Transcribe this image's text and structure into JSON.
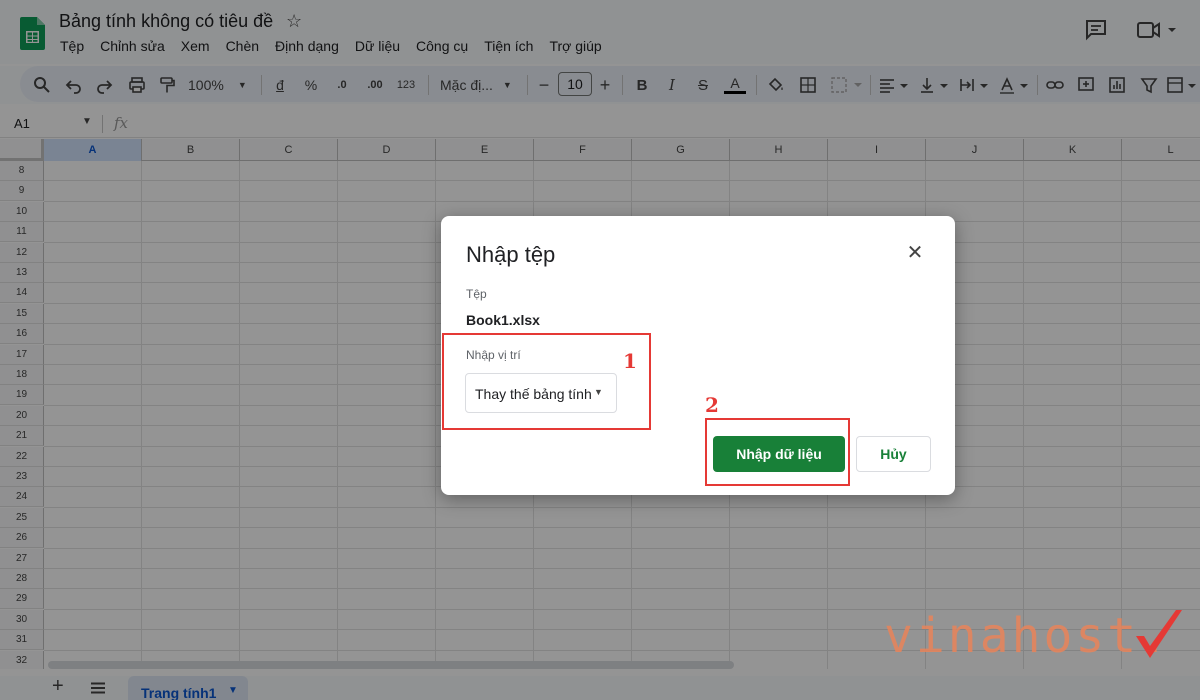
{
  "header": {
    "doc_title": "Bảng tính không có tiêu đề",
    "menu": [
      "Tệp",
      "Chỉnh sửa",
      "Xem",
      "Chèn",
      "Định dạng",
      "Dữ liệu",
      "Công cụ",
      "Tiện ích",
      "Trợ giúp"
    ]
  },
  "toolbar": {
    "zoom": "100%",
    "currency": "đ",
    "percent": "%",
    "dec_less": ".0",
    "dec_more": ".00",
    "number_format": "123",
    "font_name": "Mặc đị...",
    "font_size": "10",
    "bold": "B",
    "italic": "I",
    "strike": "S",
    "text_color": "A"
  },
  "formula_bar": {
    "name_box": "A1",
    "fx": "fx"
  },
  "grid": {
    "columns": [
      "A",
      "B",
      "C",
      "D",
      "E",
      "F",
      "G",
      "H",
      "I",
      "J",
      "K",
      "L"
    ],
    "rows": [
      "8",
      "9",
      "10",
      "11",
      "12",
      "13",
      "14",
      "15",
      "16",
      "17",
      "18",
      "19",
      "20",
      "21",
      "22",
      "23",
      "24",
      "25",
      "26",
      "27",
      "28",
      "29",
      "30",
      "31",
      "32"
    ]
  },
  "bottom_bar": {
    "add_sheet": "+",
    "sheet_tab": "Trang tính1"
  },
  "dialog": {
    "title": "Nhập tệp",
    "file_label": "Tệp",
    "file_name": "Book1.xlsx",
    "location_label": "Nhập vị trí",
    "location_value": "Thay thế bảng tính",
    "import_button": "Nhập dữ liệu",
    "cancel_button": "Hủy"
  },
  "annotations": {
    "step1": "1",
    "step2": "2",
    "color": "#e53935"
  },
  "watermark": {
    "text": "vinahost."
  },
  "colors": {
    "import_button": "#188038",
    "sheet_tab_text": "#0b57d0",
    "overlay": "rgba(0,0,0,0.42)"
  }
}
